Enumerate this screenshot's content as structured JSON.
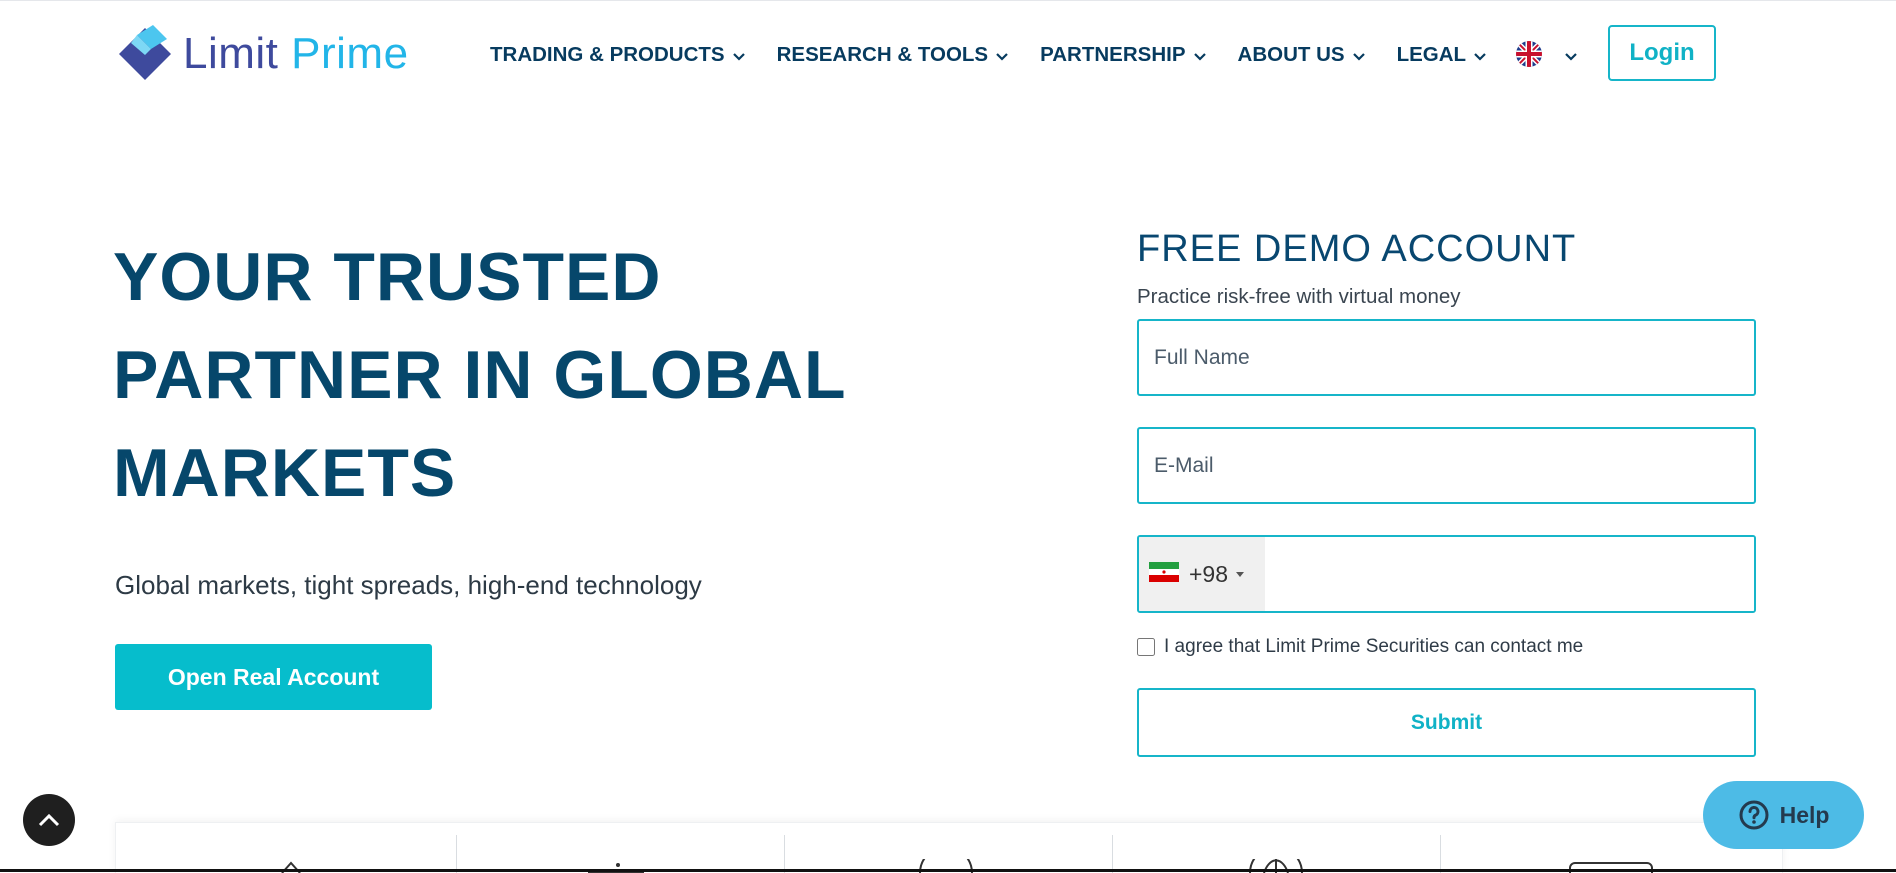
{
  "brand": {
    "name_part1": "Limit",
    "name_part2": "Prime"
  },
  "nav": {
    "items": [
      {
        "label": "TRADING & PRODUCTS"
      },
      {
        "label": "RESEARCH & TOOLS"
      },
      {
        "label": "PARTNERSHIP"
      },
      {
        "label": "ABOUT US"
      },
      {
        "label": "LEGAL"
      }
    ],
    "language_icon": "uk-flag-icon",
    "login_label": "Login"
  },
  "hero": {
    "title": "YOUR TRUSTED PARTNER IN GLOBAL MARKETS",
    "subtitle": "Global markets, tight spreads, high-end technology",
    "cta_label": "Open Real Account"
  },
  "demo_form": {
    "title": "FREE DEMO ACCOUNT",
    "subtitle": "Practice risk-free with virtual money",
    "full_name_placeholder": "Full Name",
    "full_name_value": "",
    "email_placeholder": "E-Mail",
    "email_value": "",
    "phone_country_icon": "iran-flag-icon",
    "phone_dial_code": "+98",
    "phone_value": "",
    "agree_label": "I agree that Limit Prime Securities can contact me",
    "agree_checked": false,
    "submit_label": "Submit"
  },
  "widgets": {
    "scroll_top_icon": "chevron-up-icon",
    "help_label": "Help",
    "help_icon": "question-circle-icon"
  },
  "colors": {
    "primary_navy": "#06476b",
    "accent_teal": "#06bdcc",
    "help_blue": "#4dbbe6"
  }
}
